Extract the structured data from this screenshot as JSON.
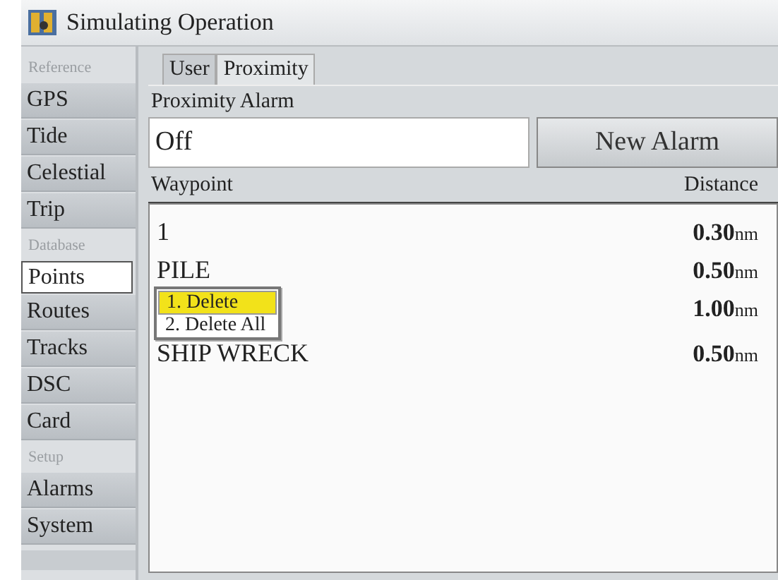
{
  "window": {
    "title": "Simulating Operation"
  },
  "sidebar": {
    "items": [
      {
        "kind": "header",
        "label": "Reference"
      },
      {
        "kind": "item",
        "label": "GPS",
        "selected": false
      },
      {
        "kind": "item",
        "label": "Tide",
        "selected": false
      },
      {
        "kind": "item",
        "label": "Celestial",
        "selected": false
      },
      {
        "kind": "item",
        "label": "Trip",
        "selected": false
      },
      {
        "kind": "header",
        "label": "Database"
      },
      {
        "kind": "item",
        "label": "Points",
        "selected": true
      },
      {
        "kind": "item",
        "label": "Routes",
        "selected": false
      },
      {
        "kind": "item",
        "label": "Tracks",
        "selected": false
      },
      {
        "kind": "item",
        "label": "DSC",
        "selected": false
      },
      {
        "kind": "item",
        "label": "Card",
        "selected": false
      },
      {
        "kind": "header",
        "label": "Setup"
      },
      {
        "kind": "item",
        "label": "Alarms",
        "selected": false
      },
      {
        "kind": "item",
        "label": "System",
        "selected": false
      }
    ]
  },
  "tabs": [
    {
      "label": "User",
      "selected": false
    },
    {
      "label": "Proximity",
      "selected": true
    }
  ],
  "proximity_alarm": {
    "label": "Proximity Alarm",
    "value": "Off"
  },
  "new_alarm_button": "New Alarm",
  "table": {
    "columns": [
      "Waypoint",
      "Distance"
    ],
    "rows": [
      {
        "name": "1",
        "distance": "**0.30**nm"
      },
      {
        "name": "PILE",
        "distance": "**0.50**nm"
      },
      {
        "distance": "**1.00**nm"
      },
      {
        "name": "SHIP WRECK",
        "distance": "**0.50**nm"
      }
    ]
  },
  "context_menu": {
    "items": [
      {
        "label": "1. Delete",
        "selected": true
      },
      {
        "label": "2. Delete  All",
        "selected": false
      }
    ]
  }
}
